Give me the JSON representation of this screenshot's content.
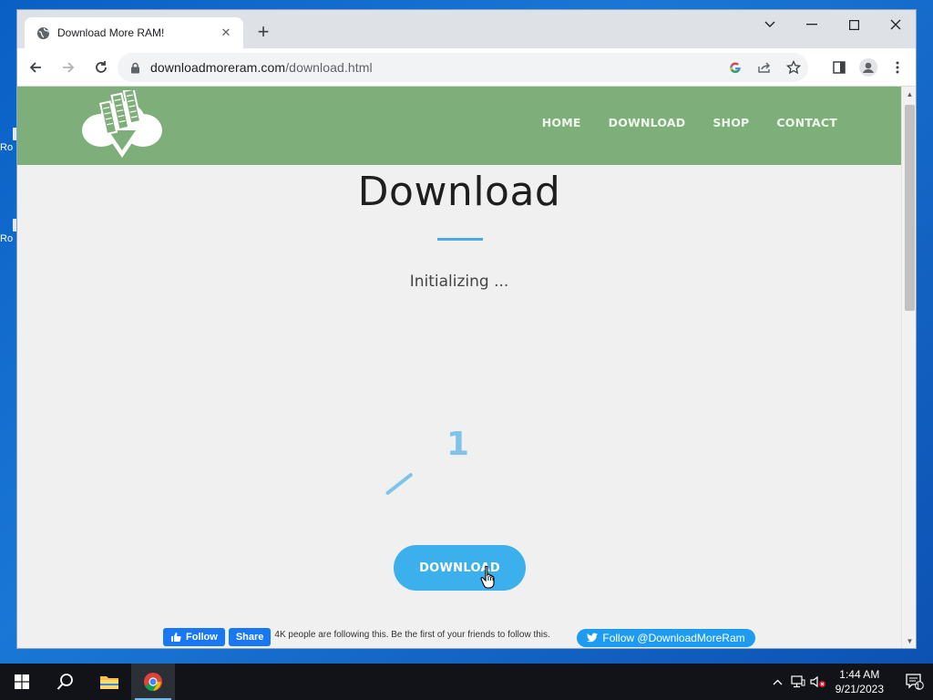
{
  "desktop": {
    "icons": [
      {
        "label": "Ro"
      },
      {
        "label": "Ro"
      }
    ]
  },
  "browser": {
    "tab": {
      "title": "Download More RAM!",
      "close_icon": "close-icon"
    },
    "new_tab_icon": "plus-icon",
    "window_controls": [
      "chevron-down-icon",
      "minimize-icon",
      "maximize-icon",
      "close-icon"
    ],
    "address": {
      "domain": "downloadmoreram.com",
      "path": "/download.html"
    }
  },
  "site": {
    "nav": [
      {
        "label": "HOME"
      },
      {
        "label": "DOWNLOAD"
      },
      {
        "label": "SHOP"
      },
      {
        "label": "CONTACT"
      }
    ],
    "title": "Download",
    "status": "Initializing ...",
    "countdown": "1",
    "download_button": "DOWNLOAD",
    "facebook": {
      "follow": "Follow",
      "share": "Share",
      "text": "4K people are following this. Be the first of your friends to follow this."
    },
    "twitter": {
      "follow": "Follow @DownloadMoreRam"
    },
    "colors": {
      "header": "#7eae79",
      "accent": "#3bb0ec"
    }
  },
  "taskbar": {
    "time": "1:44 AM",
    "date": "9/21/2023",
    "notification_count": "1"
  }
}
